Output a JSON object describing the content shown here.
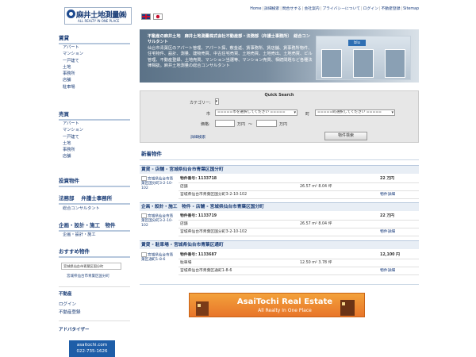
{
  "logo": {
    "name": "麻井土地測量㈱",
    "tagline": "ALL REALTY IN ONE PLACE"
  },
  "lang": {
    "en": "English",
    "jp": "日本語"
  },
  "topnav": [
    "Home",
    "詳細検索",
    "問合せする",
    "会社案内",
    "プライバシーについて",
    "ログイン",
    "不動産登録",
    "Sitemap"
  ],
  "sidebar": {
    "rent_title": "賃貸",
    "rent_items": [
      "アパート",
      "マンション",
      "一戸建て",
      "土地",
      "事務所",
      "店舗",
      "駐車場"
    ],
    "sale_title": "売買",
    "sale_items": [
      "アパート",
      "マンション",
      "一戸建て",
      "土地",
      "事務所",
      "店舗"
    ],
    "invest_title": "投資物件",
    "legal_title": "法務部　 弁護士事務所",
    "consult": "総合コンサルタント",
    "plan_title": "企画・設計・施工　物件",
    "plan_sub": "企画・設計・施工",
    "recommend_title": "おすすめ物件",
    "recommend_thumb": "宮城県仙台市青葉区国分町",
    "recommend_caption": "宮城県仙台市青葉区国分町",
    "realestate_title": "不動産",
    "login": "ログイン",
    "register": "不動産登録",
    "advertiser_title": "アドバタイザー",
    "adv_box_line1": "asaitochi.com",
    "adv_box_line2": "022-735-1626"
  },
  "banner": {
    "line1": "不動産の麻井土地　麻井土地測量株式会社不動産部・法務部（弁護士事務所）　総合コンサルタント",
    "line2": "仙台市青葉区のアパート管理、アパート探、敷金返、賃事務所、賃店舗、賃事務所物件、住宅物件、設計、測量、建物売買、中古住宅売買、土地売買、土地売出、土地売買、ビル管理、不動産登録、土地売買、マンション当選等、マンション売買、相続問題など各種法律相談。麻井土地測量の総合コンサルタント",
    "shop_sign": "blu"
  },
  "quick_search": {
    "title": "Quick Search",
    "category_label": "カテゴリー:",
    "city_label": "市",
    "city_select": "=====市を選択してください =====",
    "town_label": "町",
    "town_select": "=====町選択してください =====",
    "price_label": "価格:",
    "price_unit1": "万円",
    "tilde": "～",
    "price_unit2": "万円",
    "detail_link": "詳細検索",
    "search_button": "物件検索"
  },
  "new_listings": {
    "title": "新着物件",
    "items": [
      {
        "category": "賃貸 - 店舗 - 宮城県仙台市青葉区国分町",
        "thumb": "宮城県仙台市青葉区国分町3-2-10-102",
        "prop_label": "物件番号: 1133718",
        "price": "22 万円",
        "type": "店舗",
        "area": "26.57 m²  8.04 坪",
        "address": "宮城県仙台市青葉区国分町3-2-10-102",
        "detail": "物件詳細"
      },
      {
        "category": "企画・設計・施工　物件 - 店舗 - 宮城県仙台市青葉区国分町",
        "thumb": "宮城県仙台市青葉区国分町3-2-10-102",
        "prop_label": "物件番号: 1133719",
        "price": "22 万円",
        "type": "店舗",
        "area": "26.57 m²  8.04 坪",
        "address": "宮城県仙台市青葉区国分町3-2-10-102",
        "detail": "物件詳細"
      },
      {
        "category": "賃貸 - 駐車場 - 宮城県仙台市青葉区通町",
        "thumb": "宮城県仙台市青葉区通町1-8-6",
        "prop_label": "物件番号: 1133687",
        "price": "12,100 円",
        "type": "駐車場",
        "area": "12.50 m²  3.78 坪",
        "address": "宮城県仙台市青葉区通町1-8-6",
        "detail": "物件詳細"
      }
    ]
  },
  "ad_banner": {
    "title": "AsaiTochi Real Estate",
    "subtitle": "All Realty In One Place"
  }
}
